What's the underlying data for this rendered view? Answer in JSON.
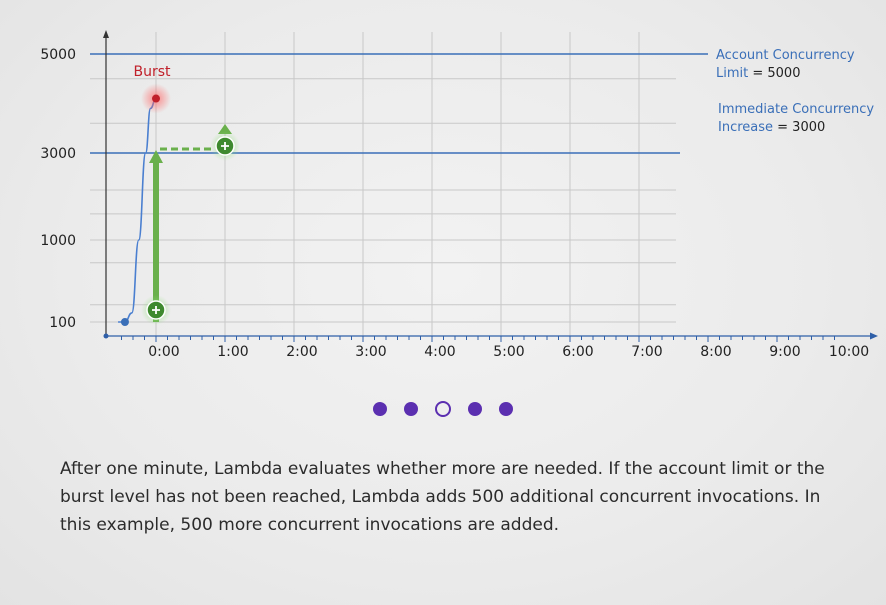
{
  "chart_data": {
    "type": "line",
    "x_tick_labels": [
      "0:00",
      "1:00",
      "2:00",
      "3:00",
      "4:00",
      "5:00",
      "6:00",
      "7:00",
      "8:00",
      "9:00",
      "10:00"
    ],
    "y_tick_labels": [
      "100",
      "1000",
      "3000",
      "5000"
    ],
    "series": [
      {
        "x": [
          -0.55,
          -0.45,
          -0.35,
          -0.25,
          -0.15,
          -0.08,
          0.0
        ],
        "y": [
          100,
          100,
          200,
          1000,
          3000,
          3900,
          4100
        ]
      }
    ],
    "points": {
      "start": {
        "x": -0.45,
        "y": 100
      },
      "burst": {
        "x": 0.0,
        "y": 4100,
        "label": "Burst"
      },
      "increase_start": {
        "x": 0.0,
        "y": 100
      },
      "increase_end": {
        "x": 1.0,
        "y": 3000
      }
    },
    "reference_lines": [
      {
        "y": 5000,
        "label": "Account Concurrency",
        "label2_name": "Limit",
        "label2_value": " = 5000"
      },
      {
        "y": 3000,
        "label": "Immediate Concurrency",
        "label2_name": "Increase",
        "label2_value": " = 3000"
      }
    ],
    "colors": {
      "axis": "#2f5fa8",
      "reference": "#3a6fb8",
      "grid": "#c8c8c8",
      "curve": "#4a7fd0",
      "burst": "#c0202a",
      "increase": "#6ab04c",
      "increase_dark": "#3e8a2e"
    }
  },
  "pagination": {
    "count": 5,
    "active": 2
  },
  "caption": "After one minute, Lambda evaluates whether more are needed. If the account limit or the burst level has not been reached, Lambda adds 500 additional concurrent invocations. In this example, 500 more concurrent invocations are added."
}
